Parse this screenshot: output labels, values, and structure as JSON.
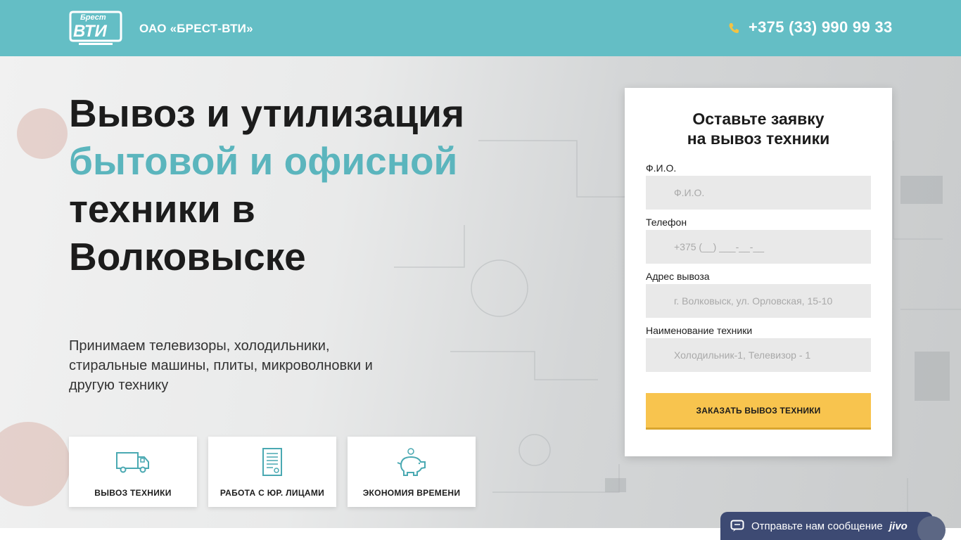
{
  "header": {
    "company": "ОАО «БРЕСТ-ВТИ»",
    "logo_top": "Брест",
    "logo_main": "ВТИ",
    "phone": "+375 (33) 990 99 33",
    "phone_icon": "phone-icon",
    "bg_color": "#64bec5"
  },
  "hero": {
    "title_line1": "Вывоз и утилизация",
    "title_accent": "бытовой и офисной",
    "title_line3": "техники в",
    "title_line4": "Волковыске",
    "subtitle": "Принимаем телевизоры, холодильники, стиральные машины, плиты, микроволновки и другую технику",
    "accent_color": "#5bb5bd"
  },
  "features": [
    {
      "label": "ВЫВОЗ ТЕХНИКИ",
      "icon": "truck-icon"
    },
    {
      "label": "РАБОТА С ЮР. ЛИЦАМИ",
      "icon": "document-icon"
    },
    {
      "label": "ЭКОНОМИЯ ВРЕМЕНИ",
      "icon": "piggy-bank-icon"
    }
  ],
  "form": {
    "title_line1": "Оставьте заявку",
    "title_line2": "на вывоз техники",
    "fields": [
      {
        "label": "Ф.И.О.",
        "placeholder": "Ф.И.О.",
        "value": ""
      },
      {
        "label": "Телефон",
        "placeholder": "+375 (__) ___-__-__",
        "value": ""
      },
      {
        "label": "Адрес вывоза",
        "placeholder": "г. Волковыск, ул. Орловская, 15-10",
        "value": ""
      },
      {
        "label": "Наименование техники",
        "placeholder": "Холодильник-1, Телевизор - 1",
        "value": ""
      }
    ],
    "submit_label": "ЗАКАЗАТЬ ВЫВОЗ ТЕХНИКИ",
    "submit_color": "#f8c44e"
  },
  "chat": {
    "label": "Отправьте нам сообщение",
    "brand": "jivo",
    "icon": "chat-bubble-icon",
    "bg_color": "#3d4a73"
  }
}
